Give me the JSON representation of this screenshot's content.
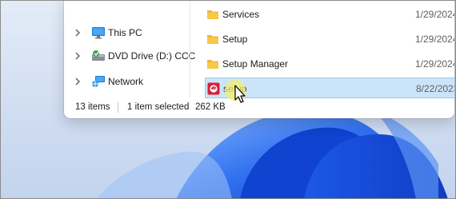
{
  "nav": {
    "items": [
      {
        "label": "This PC",
        "icon": "monitor-icon"
      },
      {
        "label": "DVD Drive (D:) CCC",
        "icon": "dvd-drive-icon"
      },
      {
        "label": "Network",
        "icon": "network-icon"
      }
    ]
  },
  "files": [
    {
      "name": "Services",
      "date": "1/29/2024",
      "icon": "folder-icon"
    },
    {
      "name": "Setup",
      "date": "1/29/2024",
      "icon": "folder-icon"
    },
    {
      "name": "Setup Manager",
      "date": "1/29/2024",
      "icon": "folder-icon"
    },
    {
      "name": "setup",
      "date": "8/22/2023",
      "icon": "setup-app-icon",
      "selected": true
    }
  ],
  "status": {
    "items_count": "13 items",
    "selection": "1 item selected",
    "size": "262 KB"
  },
  "colors": {
    "selection_bg": "#cce4f7",
    "selection_border": "#99c9ef",
    "folder": "#f4c54a",
    "setup_icon": "#d6203a",
    "desktop_blue": "#1f5fe0"
  }
}
